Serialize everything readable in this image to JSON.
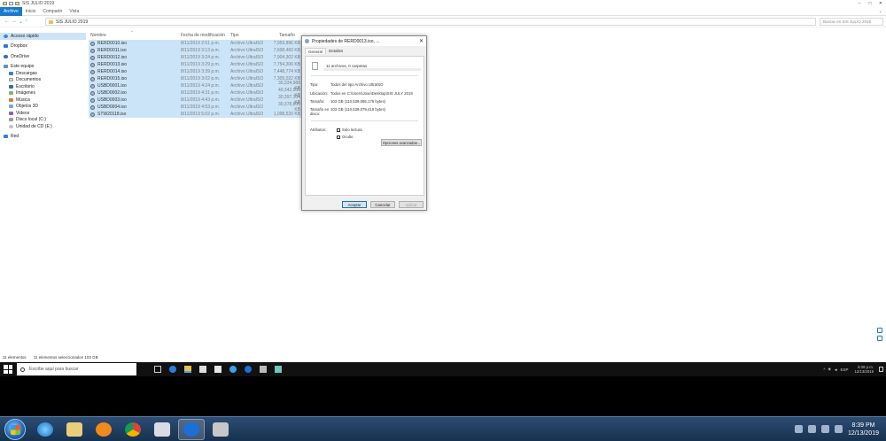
{
  "explorer": {
    "title": "SIS JULIO 2019",
    "ribbon_tabs": [
      "Archivo",
      "Inicio",
      "Compartir",
      "Vista"
    ],
    "address": "SIS JULIO 2019",
    "search_placeholder": "Buscar en SIS JULIO 2019",
    "nav": {
      "quick_access": "Acceso rápido",
      "dropbox": "Dropbox",
      "onedrive": "OneDrive",
      "this_pc": "Este equipo",
      "downloads": "Descargas",
      "documents": "Documentos",
      "desktop": "Escritorio",
      "pictures": "Imágenes",
      "music": "Música",
      "objects3d": "Objetos 3D",
      "videos": "Videos",
      "local_disk": "Disco local (C:)",
      "cd_drive": "Unidad de CD (E:)",
      "network": "Red"
    },
    "columns": {
      "name": "Nombre",
      "date": "Fecha de modificación",
      "type": "Tipo",
      "size": "Tamaño"
    },
    "files": [
      {
        "name": "RERD0010.iso",
        "date": "8/11/2019 2:51 p.m.",
        "type": "Archivo UltraISO",
        "size": "7,959,896 KB"
      },
      {
        "name": "RERD0011.iso",
        "date": "8/11/2019 3:13 p.m.",
        "type": "Archivo UltraISO",
        "size": "7,608,460 KB"
      },
      {
        "name": "RERD0012.iso",
        "date": "8/11/2019 3:24 p.m.",
        "type": "Archivo UltraISO",
        "size": "7,904,302 KB"
      },
      {
        "name": "RERD0013.iso",
        "date": "8/11/2019 3:29 p.m.",
        "type": "Archivo UltraISO",
        "size": "7,754,306 KB"
      },
      {
        "name": "RERD0014.iso",
        "date": "8/11/2019 3:39 p.m.",
        "type": "Archivo UltraISO",
        "size": "7,448,774 KB"
      },
      {
        "name": "RERD0015.iso",
        "date": "8/11/2019 3:02 p.m.",
        "type": "Archivo UltraISO",
        "size": "7,305,022 KB"
      },
      {
        "name": "USBD0001.iso",
        "date": "8/11/2019 4:24 p.m.",
        "type": "Archivo UltraISO",
        "size": "30,334,986 KB"
      },
      {
        "name": "USBD0002.iso",
        "date": "8/11/2019 4:31 p.m.",
        "type": "Archivo UltraISO",
        "size": "40,342,900 KB"
      },
      {
        "name": "USBD0003.iso",
        "date": "8/11/2019 4:43 p.m.",
        "type": "Archivo UltraISO",
        "size": "30,397,104 KB"
      },
      {
        "name": "USBD0004.iso",
        "date": "8/11/2019 4:53 p.m.",
        "type": "Archivo UltraISO",
        "size": "30,378,800 KB"
      },
      {
        "name": "STW20118.iso",
        "date": "8/11/2019 5:02 p.m.",
        "type": "Archivo UltraISO",
        "size": "1,098,520 KB"
      }
    ],
    "status": {
      "count": "11 elementos",
      "selected": "11 elementos seleccionados  103 GB"
    }
  },
  "dialog": {
    "title": "Propiedades de RERD0013.iso, ...",
    "close": "✕",
    "tabs": [
      "General",
      "Detalles"
    ],
    "summary": "11 archivos, 0 carpetas",
    "type_label": "Tipo:",
    "type_value": "Todos del tipo Archivo UltraISO",
    "location_label": "Ubicación:",
    "location_value": "Todos en C:\\Users\\Jose\\Desktop\\SIS JULY 2019",
    "size_label": "Tamaño:",
    "size_value": "103 GB (110,539,065,176 bytes)",
    "disk_size_label": "Tamaño en disco:",
    "disk_size_value": "103 GB (110,539,079,418 bytes)",
    "attributes_label": "Atributos:",
    "readonly_label": "Solo lectura",
    "hidden_label": "Oculto",
    "advanced_button": "Opciones avanzadas...",
    "ok": "Aceptar",
    "cancel": "Cancelar",
    "apply": "Aplicar"
  },
  "remote_taskbar": {
    "search_placeholder": "Escribe aquí para buscar",
    "lang": "ESP",
    "time": "8:39 p.m.",
    "date": "12/13/2019"
  },
  "local_taskbar": {
    "time": "8:39 PM",
    "date": "12/13/2019"
  },
  "colors": {
    "selection": "#cce4f7",
    "accent": "#1979ca",
    "remote_taskbar": "#111111",
    "local_taskbar": "#1f3c5f"
  }
}
